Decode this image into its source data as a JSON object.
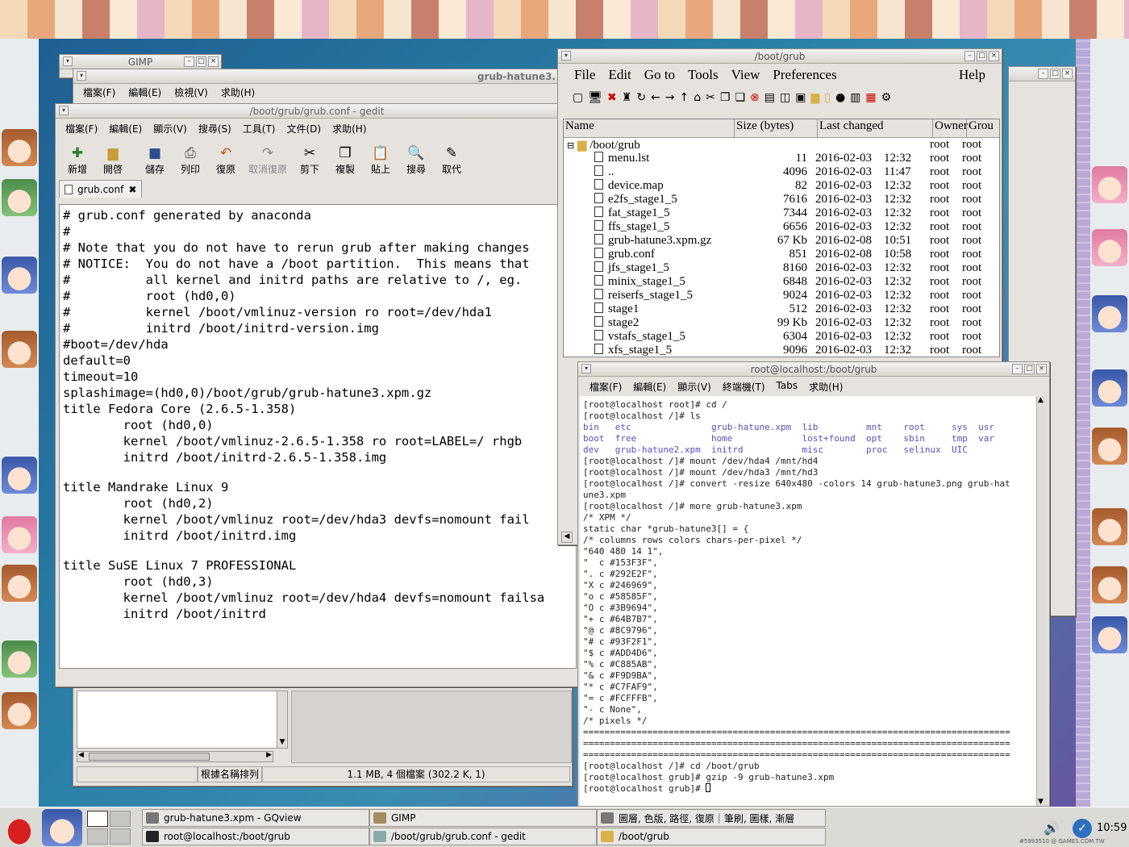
{
  "taskbar": {
    "tasks": [
      "grub-hatune3.xpm - GQview",
      "GIMP",
      "圖層, 色版, 路徑, 復原｜筆刷, 圖樣, 漸層",
      "root@localhost:/boot/grub",
      "/boot/grub/grub.conf - gedit",
      "/boot/grub"
    ],
    "clock": "10:59",
    "watermark": "#5993510 @ GAMES.COM.TW"
  },
  "gimp": {
    "title": "GIMP"
  },
  "gqview": {
    "title": "grub-hatune3.",
    "menu": [
      "檔案(F)",
      "編輯(E)",
      "檢視(V)",
      "求助(H)"
    ],
    "sort_label": "根據名稱排列",
    "status": "1.1 MB, 4 個檔案 (302.2 K, 1)"
  },
  "gedit": {
    "title": "/boot/grub/grub.conf - gedit",
    "menu": [
      "檔案(F)",
      "編輯(E)",
      "顯示(V)",
      "搜尋(S)",
      "工具(T)",
      "文件(D)",
      "求助(H)"
    ],
    "toolbar": [
      "新增",
      "開啓",
      "儲存",
      "列印",
      "復原",
      "取消復原",
      "剪下",
      "複製",
      "貼上",
      "搜尋",
      "取代"
    ],
    "tab": "grub.conf",
    "lines": [
      "# grub.conf generated by anaconda",
      "#",
      "# Note that you do not have to rerun grub after making changes",
      "# NOTICE:  You do not have a /boot partition.  This means that",
      "#          all kernel and initrd paths are relative to /, eg.",
      "#          root (hd0,0)",
      "#          kernel /boot/vmlinuz-version ro root=/dev/hda1",
      "#          initrd /boot/initrd-version.img",
      "#boot=/dev/hda",
      "default=0",
      "timeout=10",
      "splashimage=(hd0,0)/boot/grub/grub-hatune3.xpm.gz",
      "title Fedora Core (2.6.5-1.358)",
      "        root (hd0,0)",
      "        kernel /boot/vmlinuz-2.6.5-1.358 ro root=LABEL=/ rhgb",
      "        initrd /boot/initrd-2.6.5-1.358.img",
      "",
      "title Mandrake Linux 9",
      "        root (hd0,2)",
      "        kernel /boot/vmlinuz root=/dev/hda3 devfs=nomount fail",
      "        initrd /boot/initrd.img",
      "",
      "title SuSE Linux 7 PROFESSIONAL",
      "        root (hd0,3)",
      "        kernel /boot/vmlinuz root=/dev/hda4 devfs=nomount failsa",
      "        initrd /boot/initrd"
    ]
  },
  "fm": {
    "title": "/boot/grub",
    "menu": [
      "File",
      "Edit",
      "Go to",
      "Tools",
      "View",
      "Preferences"
    ],
    "help": "Help",
    "headers": [
      "Name",
      "Size (bytes)",
      "Last changed",
      "Owner",
      "Grou"
    ],
    "folder": {
      "name": "/boot/grub",
      "owner": "root",
      "group": "root"
    },
    "files": [
      [
        "menu.lst",
        "11",
        "2016-02-03",
        "12:32",
        "root",
        "root"
      ],
      [
        "..",
        "4096",
        "2016-02-03",
        "11:47",
        "root",
        "root"
      ],
      [
        "device.map",
        "82",
        "2016-02-03",
        "12:32",
        "root",
        "root"
      ],
      [
        "e2fs_stage1_5",
        "7616",
        "2016-02-03",
        "12:32",
        "root",
        "root"
      ],
      [
        "fat_stage1_5",
        "7344",
        "2016-02-03",
        "12:32",
        "root",
        "root"
      ],
      [
        "ffs_stage1_5",
        "6656",
        "2016-02-03",
        "12:32",
        "root",
        "root"
      ],
      [
        "grub-hatune3.xpm.gz",
        "67 Kb",
        "2016-02-08",
        "10:51",
        "root",
        "root"
      ],
      [
        "grub.conf",
        "851",
        "2016-02-08",
        "10:58",
        "root",
        "root"
      ],
      [
        "jfs_stage1_5",
        "8160",
        "2016-02-03",
        "12:32",
        "root",
        "root"
      ],
      [
        "minix_stage1_5",
        "6848",
        "2016-02-03",
        "12:32",
        "root",
        "root"
      ],
      [
        "reiserfs_stage1_5",
        "9024",
        "2016-02-03",
        "12:32",
        "root",
        "root"
      ],
      [
        "stage1",
        "512",
        "2016-02-03",
        "12:32",
        "root",
        "root"
      ],
      [
        "stage2",
        "99 Kb",
        "2016-02-03",
        "12:32",
        "root",
        "root"
      ],
      [
        "vstafs_stage1_5",
        "6304",
        "2016-02-03",
        "12:32",
        "root",
        "root"
      ],
      [
        "xfs_stage1_5",
        "9096",
        "2016-02-03",
        "12:32",
        "root",
        "root"
      ]
    ]
  },
  "terminal": {
    "title": "root@localhost:/boot/grub",
    "menu": [
      "檔案(F)",
      "編輯(E)",
      "顯示(V)",
      "終端機(T)",
      "Tabs",
      "求助(H)"
    ],
    "lines": [
      "[root@localhost root]# cd /",
      "[root@localhost /]# ls",
      "bin   etc               grub-hatune.xpm  lib         mnt    root     sys  usr",
      "boot  free              home             lost+found  opt    sbin     tmp  var",
      "dev   grub-hatune2.xpm  initrd           misc        proc   selinux  UIC",
      "[root@localhost /]# mount /dev/hda4 /mnt/hd4",
      "[root@localhost /]# mount /dev/hda3 /mnt/hd3",
      "[root@localhost /]# convert -resize 640x480 -colors 14 grub-hatune3.png grub-hat",
      "une3.xpm",
      "[root@localhost /]# more grub-hatune3.xpm",
      "/* XPM */",
      "static char *grub-hatune3[] = {",
      "/* columns rows colors chars-per-pixel */",
      "\"640 480 14 1\",",
      "\"  c #153F3F\",",
      "\". c #292E2F\",",
      "\"X c #246969\",",
      "\"o c #58585F\",",
      "\"O c #3B9694\",",
      "\"+ c #64B7B7\",",
      "\"@ c #8C9796\",",
      "\"# c #93F2F1\",",
      "\"$ c #ADD4D6\",",
      "\"% c #C885AB\",",
      "\"& c #F9D9BA\",",
      "\"* c #C7FAF9\",",
      "\"= c #FCFFFB\",",
      "\"- c None\",",
      "/* pixels */",
      "================================================================================",
      "================================================================================",
      "================================================================================",
      "[root@localhost /]# cd /boot/grub",
      "[root@localhost grub]# gzip -9 grub-hatune3.xpm",
      "[root@localhost grub]# "
    ]
  }
}
